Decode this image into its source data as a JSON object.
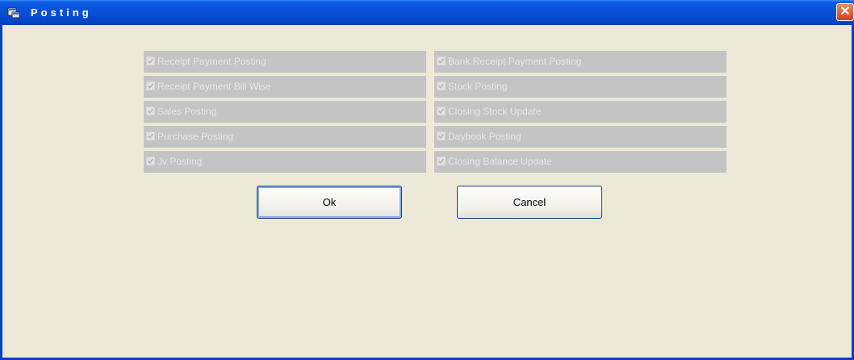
{
  "window": {
    "title": "Posting",
    "close_glyph": "✕"
  },
  "options_left": [
    {
      "label": "Receipt Payment Posting",
      "checked": true,
      "enabled": false
    },
    {
      "label": "Receipt Payment Bill Wise",
      "checked": true,
      "enabled": false
    },
    {
      "label": "Sales Posting",
      "checked": true,
      "enabled": false
    },
    {
      "label": "Purchase Posting",
      "checked": true,
      "enabled": false
    },
    {
      "label": "Jv Posting",
      "checked": true,
      "enabled": false
    }
  ],
  "options_right": [
    {
      "label": "Bank Receipt Payment Posting",
      "checked": true,
      "enabled": false
    },
    {
      "label": "Stock Posting",
      "checked": true,
      "enabled": false
    },
    {
      "label": "Closing Stock Update",
      "checked": true,
      "enabled": false
    },
    {
      "label": "Daybook  Posting",
      "checked": true,
      "enabled": false
    },
    {
      "label": "Closing Balance Update",
      "checked": true,
      "enabled": false
    }
  ],
  "buttons": {
    "ok_label": "Ok",
    "cancel_label": "Cancel"
  },
  "colors": {
    "titlebar": "#0a50d8",
    "dialog_bg": "#ece9d8",
    "option_bg": "#c4c4c4",
    "disabled_text": "#e6e6e6"
  }
}
